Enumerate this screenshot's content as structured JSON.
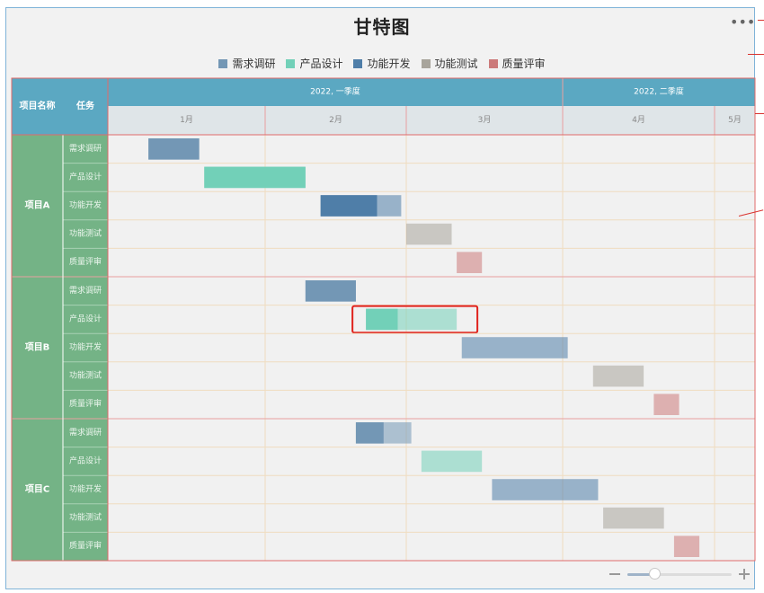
{
  "chart_data": {
    "type": "gantt",
    "title": "甘特图",
    "legend": [
      "需求调研",
      "产品设计",
      "功能开发",
      "功能测试",
      "质量评审"
    ],
    "colors": [
      "#7397b5",
      "#72d0b8",
      "#4f7ea8",
      "#a8a49b",
      "#cc7a7a"
    ],
    "header": {
      "col_project": "项目名称",
      "col_task": "任务",
      "quarters": [
        "2022, 一季度",
        "2022, 二季度"
      ],
      "months": [
        "1月",
        "2月",
        "3月",
        "4月",
        "5月"
      ]
    },
    "projects": [
      {
        "name": "项目A",
        "tasks": [
          {
            "name": "需求调研",
            "start": "2022-01-09",
            "end": "2022-01-19",
            "progress": 1.0
          },
          {
            "name": "产品设计",
            "start": "2022-01-20",
            "end": "2022-02-09",
            "progress": 1.0
          },
          {
            "name": "功能开发",
            "start": "2022-02-12",
            "end": "2022-02-28",
            "progress": 0.7
          },
          {
            "name": "功能测试",
            "start": "2022-03-01",
            "end": "2022-03-10",
            "progress": 0.0
          },
          {
            "name": "质量评审",
            "start": "2022-03-11",
            "end": "2022-03-16",
            "progress": 0.0
          }
        ]
      },
      {
        "name": "项目B",
        "tasks": [
          {
            "name": "需求调研",
            "start": "2022-02-09",
            "end": "2022-02-19",
            "progress": 1.0
          },
          {
            "name": "产品设计",
            "start": "2022-02-21",
            "end": "2022-03-11",
            "progress": 0.35
          },
          {
            "name": "功能开发",
            "start": "2022-03-12",
            "end": "2022-04-02",
            "progress": 0.0
          },
          {
            "name": "功能测试",
            "start": "2022-04-07",
            "end": "2022-04-17",
            "progress": 0.0
          },
          {
            "name": "质量评审",
            "start": "2022-04-19",
            "end": "2022-04-24",
            "progress": 0.0
          }
        ]
      },
      {
        "name": "项目C",
        "tasks": [
          {
            "name": "需求调研",
            "start": "2022-02-19",
            "end": "2022-03-02",
            "progress": 0.5
          },
          {
            "name": "产品设计",
            "start": "2022-03-04",
            "end": "2022-03-16",
            "progress": 0.0
          },
          {
            "name": "功能开发",
            "start": "2022-03-18",
            "end": "2022-04-08",
            "progress": 0.0
          },
          {
            "name": "功能测试",
            "start": "2022-04-09",
            "end": "2022-04-21",
            "progress": 0.0
          },
          {
            "name": "质量评审",
            "start": "2022-04-23",
            "end": "2022-04-28",
            "progress": 0.0
          }
        ]
      }
    ],
    "highlight": {
      "project": "项目B",
      "task": "产品设计",
      "color": "#e0221c"
    },
    "grid": true,
    "legend_position": "top"
  },
  "toolbar": {
    "more_label": "•••"
  }
}
